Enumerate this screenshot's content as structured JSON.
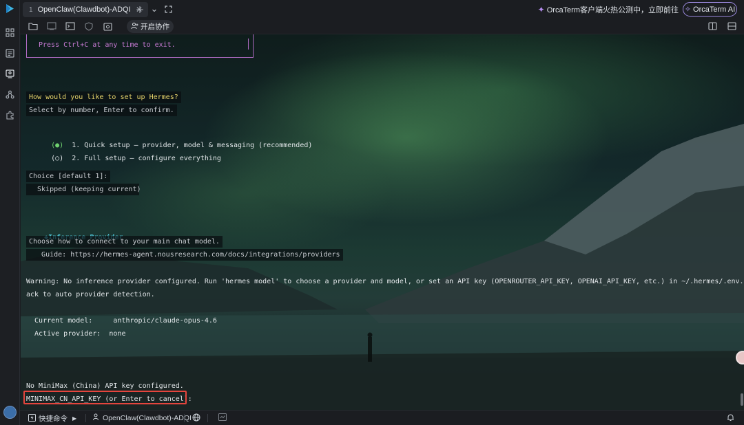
{
  "tabs": [
    {
      "index": "1",
      "title": "OpenClaw(Clawdbot)-ADQI"
    }
  ],
  "tabbar": {
    "new_tab_icon": "plus-icon",
    "dropdown_icon": "chevron-down-icon",
    "fullscreen_icon": "expand-icon",
    "promo_text": "OrcaTerm客户端火热公测中，立即前往",
    "ai_button_label": "OrcaTerm AI"
  },
  "toolbar": {
    "collab_label": "开启协作"
  },
  "terminal": {
    "lines": {
      "ctrl_c": "Press Ctrl+C at any time to exit.",
      "question": "How would you like to set up Hermes?",
      "select_hint": "Select by number, Enter to confirm.",
      "opt1_marker": "(●)",
      "opt1_text": "1. Quick setup — provider, model & messaging (recommended)",
      "opt2_marker": "(○)",
      "opt2_text": "2. Full setup — configure everything",
      "choice": "Choice [default 1]:",
      "skipped": "  Skipped (keeping current)",
      "section_marker": "◆",
      "section_title": "Inference Provider",
      "connect_hint": "Choose how to connect to your main chat model.",
      "guide": "   Guide: https://hermes-agent.nousresearch.com/docs/integrations/providers",
      "warning_1": "Warning: No inference provider configured. Run 'hermes model' to choose a provider and model, or set an API key (OPENROUTER_API_KEY, OPENAI_API_KEY, etc.) in ~/.hermes/.env. Falling b",
      "warning_2": "ack to auto provider detection.",
      "current_model": "  Current model:     anthropic/claude-opus-4.6",
      "active_provider": "  Active provider:  none",
      "no_key": "No MiniMax (China) API key configured.",
      "prompt": "MINIMAX_CN_API_KEY (or Enter to cancel):"
    }
  },
  "statusbar": {
    "shortcuts_label": "快捷命令",
    "session_label": "OpenClaw(Clawdbot)-ADQI"
  },
  "colors": {
    "accent_purple": "#9c8ae0",
    "highlight_red": "#e5453d",
    "prompt_yellow": "#e6d46b",
    "section_cyan": "#4fc7d9"
  }
}
